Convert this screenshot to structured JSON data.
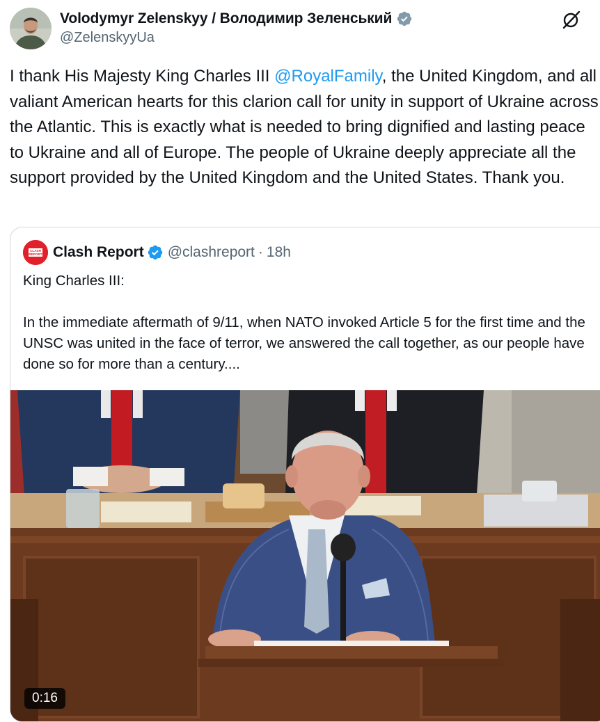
{
  "author": {
    "display_name": "Volodymyr Zelenskyy / Володимир Зеленський",
    "handle": "@ZelenskyyUa",
    "avatar_icon": "profile-photo",
    "verified_icon": "verified-badge-icon"
  },
  "tweet": {
    "text_before": "I thank His Majesty King Charles III ",
    "mention": "@RoyalFamily",
    "text_after": ", the United Kingdom, and all valiant American hearts for this clarion call for unity in support of Ukraine across the Atlantic. This is exactly what is needed to bring dignified and lasting peace to Ukraine and all of Europe. The people of Ukraine deeply appreciate all the support provided by the United Kingdom and the United States. Thank you."
  },
  "quoted": {
    "display_name": "Clash Report",
    "handle": "@clashreport",
    "separator": "·",
    "time": "18h",
    "avatar_text": "CLASH REPORT",
    "text": "King Charles III:\n\nIn the immediate aftermath of 9/11, when NATO invoked Article 5 for the first time and the UNSC was united in the face of terror, we answered the call together, as our people have done so for more than a century....",
    "video_duration": "0:16"
  },
  "colors": {
    "link": "#1d9bf0",
    "verified_gray": "#829aab",
    "verified_blue": "#1d9bf0",
    "clash_red": "#e0202b",
    "text_secondary": "#536471"
  }
}
